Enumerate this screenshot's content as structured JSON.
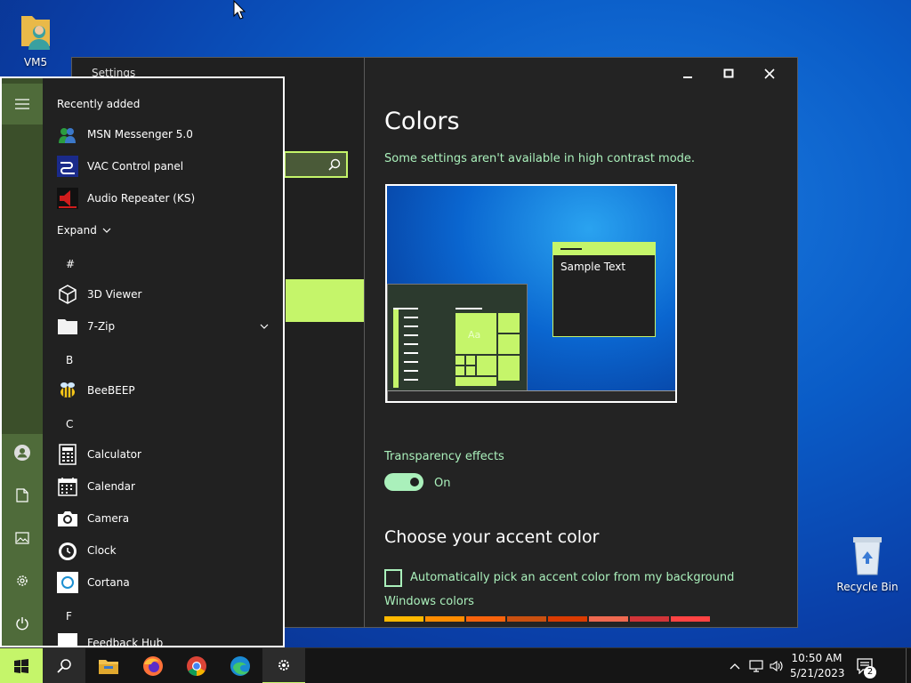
{
  "desktop": {
    "icons": [
      {
        "label": "VM5",
        "icon": "user-folder-icon"
      },
      {
        "label": "Recycle Bin",
        "icon": "recycle-bin-icon"
      }
    ]
  },
  "settings": {
    "title": "Settings",
    "search_placeholder": "",
    "page_title": "Colors",
    "high_contrast_note": "Some settings aren't available in high contrast mode.",
    "preview_sample_text": "Sample Text",
    "preview_tile_text": "Aa",
    "transparency": {
      "label": "Transparency effects",
      "state": "On",
      "enabled": true
    },
    "accent_heading": "Choose your accent color",
    "auto_accent_label": "Automatically pick an accent color from my background",
    "auto_accent_checked": false,
    "windows_colors_label": "Windows colors",
    "colors": {
      "accent": "#c5f56a",
      "accent_text": "#aaf0bb",
      "bg": "#202020"
    }
  },
  "start_menu": {
    "recently_added_label": "Recently added",
    "recent": [
      {
        "label": "MSN Messenger 5.0",
        "icon": "msn-messenger-icon"
      },
      {
        "label": "VAC Control panel",
        "icon": "vac-control-icon"
      },
      {
        "label": "Audio Repeater (KS)",
        "icon": "audio-repeater-icon"
      }
    ],
    "expand_label": "Expand",
    "groups": [
      {
        "letter": "#",
        "apps": [
          {
            "label": "3D Viewer",
            "icon": "cube-icon"
          },
          {
            "label": "7-Zip",
            "icon": "folder-icon"
          }
        ]
      },
      {
        "letter": "B",
        "apps": [
          {
            "label": "BeeBEEP",
            "icon": "bee-icon"
          }
        ]
      },
      {
        "letter": "C",
        "apps": [
          {
            "label": "Calculator",
            "icon": "calculator-icon"
          },
          {
            "label": "Calendar",
            "icon": "calendar-icon"
          },
          {
            "label": "Camera",
            "icon": "camera-icon"
          },
          {
            "label": "Clock",
            "icon": "clock-icon"
          },
          {
            "label": "Cortana",
            "icon": "cortana-icon"
          }
        ]
      },
      {
        "letter": "F",
        "apps": [
          {
            "label": "Feedback Hub",
            "icon": "feedback-icon"
          }
        ]
      }
    ]
  },
  "taskbar": {
    "time": "10:50 AM",
    "date": "5/21/2023",
    "notification_count": "2"
  }
}
